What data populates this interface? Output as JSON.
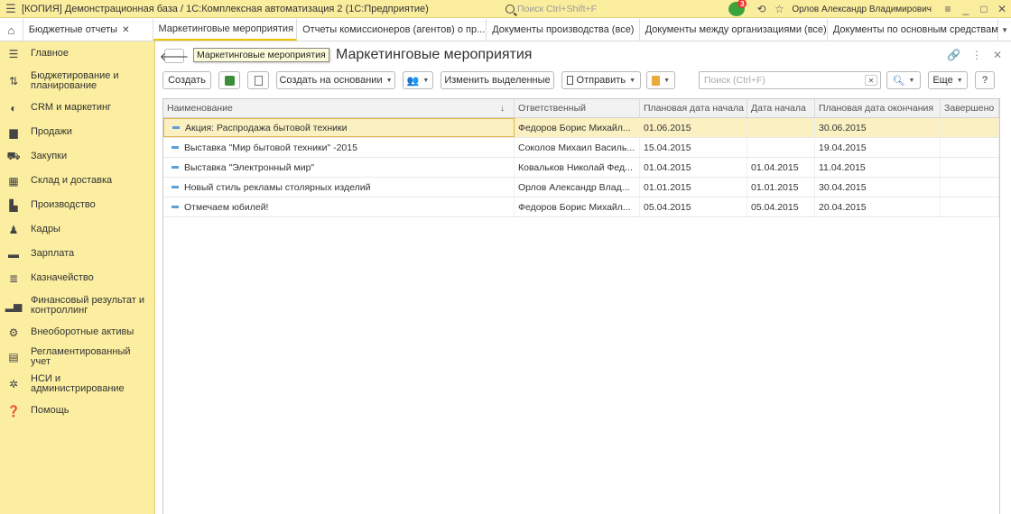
{
  "titlebar": {
    "title": "[КОПИЯ] Демонстрационная база / 1С:Комплексная автоматизация 2  (1С:Предприятие)",
    "search_placeholder": "Поиск Ctrl+Shift+F",
    "notification_count": "3",
    "user": "Орлов Александр Владимирович"
  },
  "tabs": [
    {
      "label": "Бюджетные отчеты"
    },
    {
      "label": "Маркетинговые мероприятия"
    },
    {
      "label": "Отчеты комиссионеров (агентов) о пр..."
    },
    {
      "label": "Документы производства (все)"
    },
    {
      "label": "Документы между организациями (все)"
    },
    {
      "label": "Документы по основным средствам"
    }
  ],
  "sidebar": {
    "items": [
      {
        "label": "Главное",
        "icon": "menu-icon"
      },
      {
        "label": "Бюджетирование и планирование",
        "icon": "budget-icon"
      },
      {
        "label": "CRM и маркетинг",
        "icon": "crm-icon"
      },
      {
        "label": "Продажи",
        "icon": "sales-icon"
      },
      {
        "label": "Закупки",
        "icon": "cart-icon"
      },
      {
        "label": "Склад и доставка",
        "icon": "warehouse-icon"
      },
      {
        "label": "Производство",
        "icon": "factory-icon"
      },
      {
        "label": "Кадры",
        "icon": "person-icon"
      },
      {
        "label": "Зарплата",
        "icon": "salary-icon"
      },
      {
        "label": "Казначейство",
        "icon": "treasury-icon"
      },
      {
        "label": "Финансовый результат и контроллинг",
        "icon": "chart-icon"
      },
      {
        "label": "Внеоборотные активы",
        "icon": "assets-icon"
      },
      {
        "label": "Регламентированный учет",
        "icon": "accounting-icon"
      },
      {
        "label": "НСИ и администрирование",
        "icon": "gear-icon"
      },
      {
        "label": "Помощь",
        "icon": "help-icon"
      }
    ]
  },
  "form": {
    "title": "Маркетинговые мероприятия",
    "tooltip": "Маркетинговые мероприятия",
    "toolbar": {
      "create": "Создать",
      "create_based_on": "Создать на основании",
      "edit_selected": "Изменить выделенные",
      "send": "Отправить",
      "search_placeholder": "Поиск (Ctrl+F)",
      "more": "Еще",
      "help": "?"
    }
  },
  "table": {
    "columns": [
      "Наименование",
      "Ответственный",
      "Плановая дата начала",
      "Дата начала",
      "Плановая дата окончания",
      "Завершено"
    ],
    "rows": [
      {
        "name": "Акция: Распродажа бытовой техники",
        "responsible": "Федоров Борис Михайл...",
        "plan_start": "01.06.2015",
        "start": "",
        "plan_end": "30.06.2015",
        "done": ""
      },
      {
        "name": "Выставка \"Мир бытовой техники\" -2015",
        "responsible": "Соколов Михаил Василь...",
        "plan_start": "15.04.2015",
        "start": "",
        "plan_end": "19.04.2015",
        "done": ""
      },
      {
        "name": "Выставка \"Электронный мир\"",
        "responsible": "Ковальков Николай Фед...",
        "plan_start": "01.04.2015",
        "start": "01.04.2015",
        "plan_end": "11.04.2015",
        "done": ""
      },
      {
        "name": "Новый стиль рекламы столярных изделий",
        "responsible": "Орлов Александр Влад...",
        "plan_start": "01.01.2015",
        "start": "01.01.2015",
        "plan_end": "30.04.2015",
        "done": ""
      },
      {
        "name": "Отмечаем юбилей!",
        "responsible": "Федоров Борис Михайл...",
        "plan_start": "05.04.2015",
        "start": "05.04.2015",
        "plan_end": "20.04.2015",
        "done": ""
      }
    ]
  }
}
